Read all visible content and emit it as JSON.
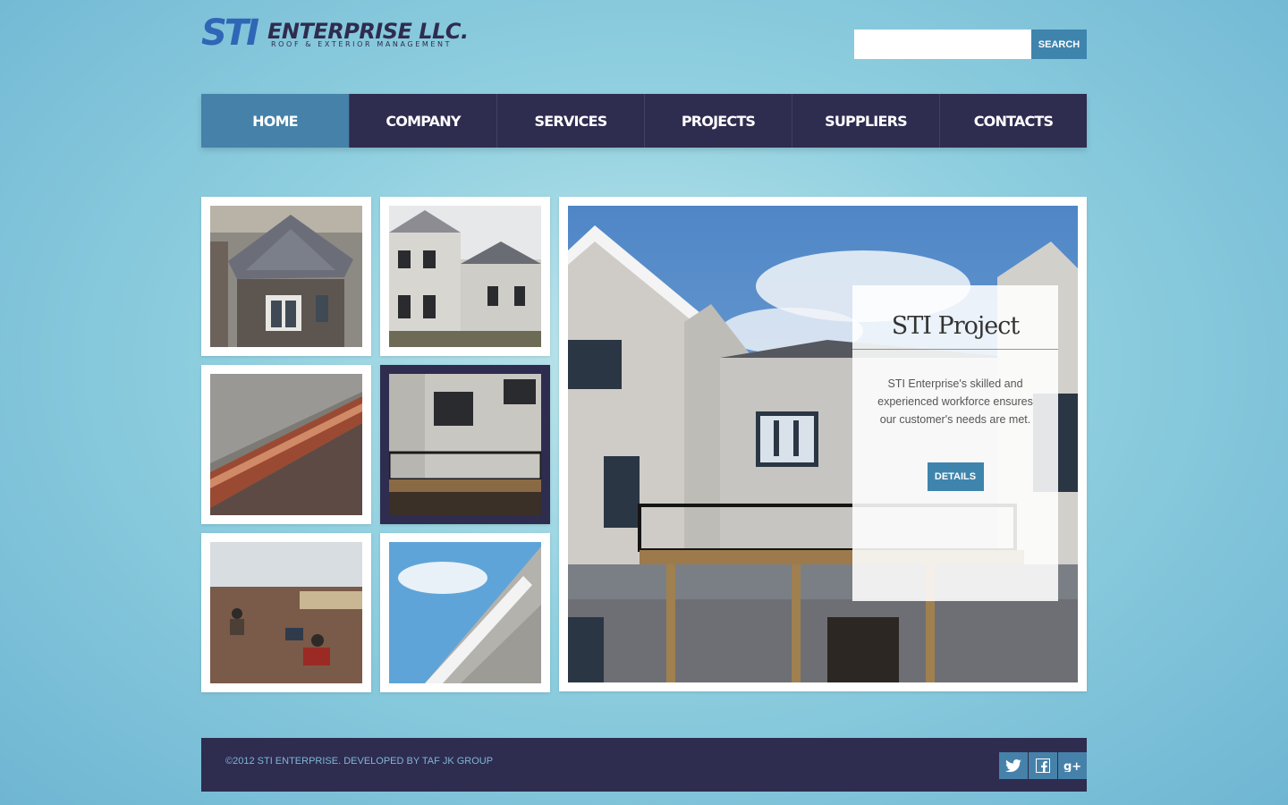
{
  "header": {
    "logo_text": "STI ENTERPRISE LLC.",
    "logo_tagline": "ROOF & EXTERIOR MANAGEMENT",
    "search": {
      "placeholder": "",
      "value": "",
      "button_label": "SEARCH"
    }
  },
  "nav": {
    "items": [
      {
        "label": "HOME",
        "active": true
      },
      {
        "label": "COMPANY",
        "active": false
      },
      {
        "label": "SERVICES",
        "active": false
      },
      {
        "label": "PROJECTS",
        "active": false
      },
      {
        "label": "SUPPLIERS",
        "active": false
      },
      {
        "label": "CONTACTS",
        "active": false
      }
    ]
  },
  "gallery": {
    "selected_index": 3,
    "thumbnails": [
      "roof-hip-stone-house-photo",
      "two-story-house-photo",
      "copper-gutter-photo",
      "rear-deck-house-photo",
      "roofers-working-photo",
      "siding-gable-photo"
    ]
  },
  "feature": {
    "title": "STI Project",
    "description": "STI Enterprise's skilled and experienced workforce ensures our customer's needs are met.",
    "button_label": "DETAILS"
  },
  "footer": {
    "copyright": "©2012 STI ENTERPRISE. DEVELOPED BY TAF JK GROUP",
    "social": [
      "twitter-icon",
      "facebook-icon",
      "google-plus-icon"
    ]
  },
  "colors": {
    "nav_bg": "#2e2c4f",
    "accent": "#4681aa",
    "button": "#3f84ad"
  }
}
